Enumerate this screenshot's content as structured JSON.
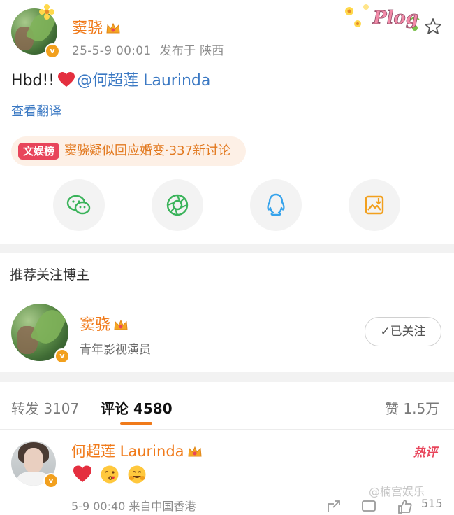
{
  "post": {
    "author_name": "窦骁",
    "time": "25-5-9 00:01",
    "published_from": "发布于 陕西",
    "text_prefix": "Hbd!!",
    "mention": "@何超莲 Laurinda",
    "translate_label": "查看翻译",
    "hot_tag": "文娱榜",
    "hot_text": "窦骁疑似回应婚变·337新讨论",
    "decoration_label": "Plog"
  },
  "share": {
    "icons": [
      "wechat-icon",
      "moments-icon",
      "qq-icon",
      "save-image-icon"
    ]
  },
  "recommend": {
    "title": "推荐关注博主",
    "name": "窦骁",
    "description": "青年影视演员",
    "follow_label": "✓已关注"
  },
  "tabs": {
    "repost": "转发 3107",
    "comment": "评论 4580",
    "like": "赞 1.5万"
  },
  "comment": {
    "author_name": "何超莲 Laurinda",
    "hot_label": "热评",
    "meta": "5-9 00:40 来自中国香港",
    "like_count": "515"
  },
  "watermark": "@楠宫娱乐",
  "colors": {
    "accent_orange": "#f07a1a",
    "link_blue": "#3a78c3",
    "hot_red": "#e8455b",
    "hot_orange": "#e2791f",
    "verified_badge": "#f2a01e"
  }
}
